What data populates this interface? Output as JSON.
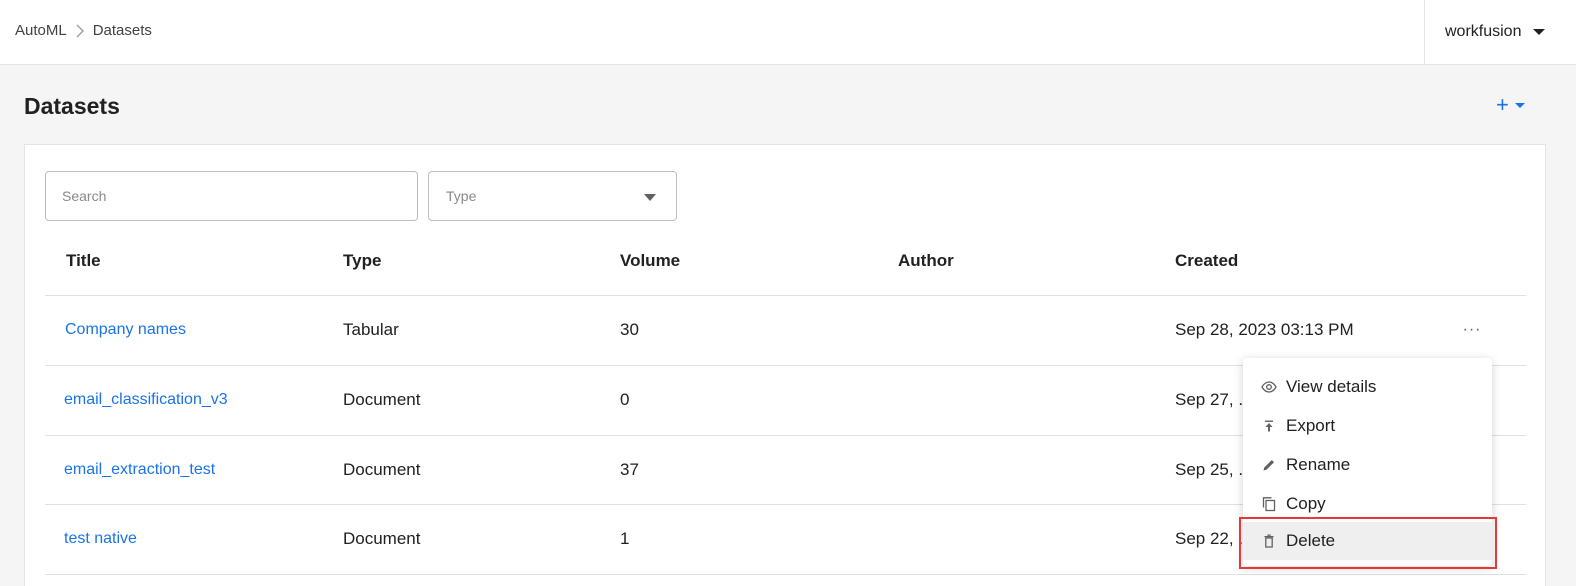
{
  "breadcrumb": {
    "root": "AutoML",
    "current": "Datasets"
  },
  "user": {
    "name": "workfusion"
  },
  "page": {
    "title": "Datasets",
    "add_label": "+"
  },
  "filters": {
    "search_placeholder": "Search",
    "type_placeholder": "Type"
  },
  "table": {
    "columns": [
      "Title",
      "Type",
      "Volume",
      "Author",
      "Created"
    ],
    "rows": [
      {
        "title": "Company names",
        "type": "Tabular",
        "volume": "30",
        "author": "",
        "created": "Sep 28, 2023 03:13 PM"
      },
      {
        "title": "email_classification_v3",
        "type": "Document",
        "volume": "0",
        "author": "",
        "created": "Sep 27, ..."
      },
      {
        "title": "email_extraction_test",
        "type": "Document",
        "volume": "37",
        "author": "",
        "created": "Sep 25, ..."
      },
      {
        "title": "test native",
        "type": "Document",
        "volume": "1",
        "author": "",
        "created": "Sep 22, ..."
      }
    ],
    "row_actions_label": "···"
  },
  "context_menu": {
    "items": [
      {
        "label": "View details",
        "icon": "eye-icon"
      },
      {
        "label": "Export",
        "icon": "export-icon"
      },
      {
        "label": "Rename",
        "icon": "pencil-icon"
      },
      {
        "label": "Copy",
        "icon": "copy-icon"
      },
      {
        "label": "Delete",
        "icon": "trash-icon"
      }
    ],
    "highlighted": "Delete"
  },
  "colors": {
    "accent": "#1a73e8",
    "highlight_border": "#e53935"
  }
}
